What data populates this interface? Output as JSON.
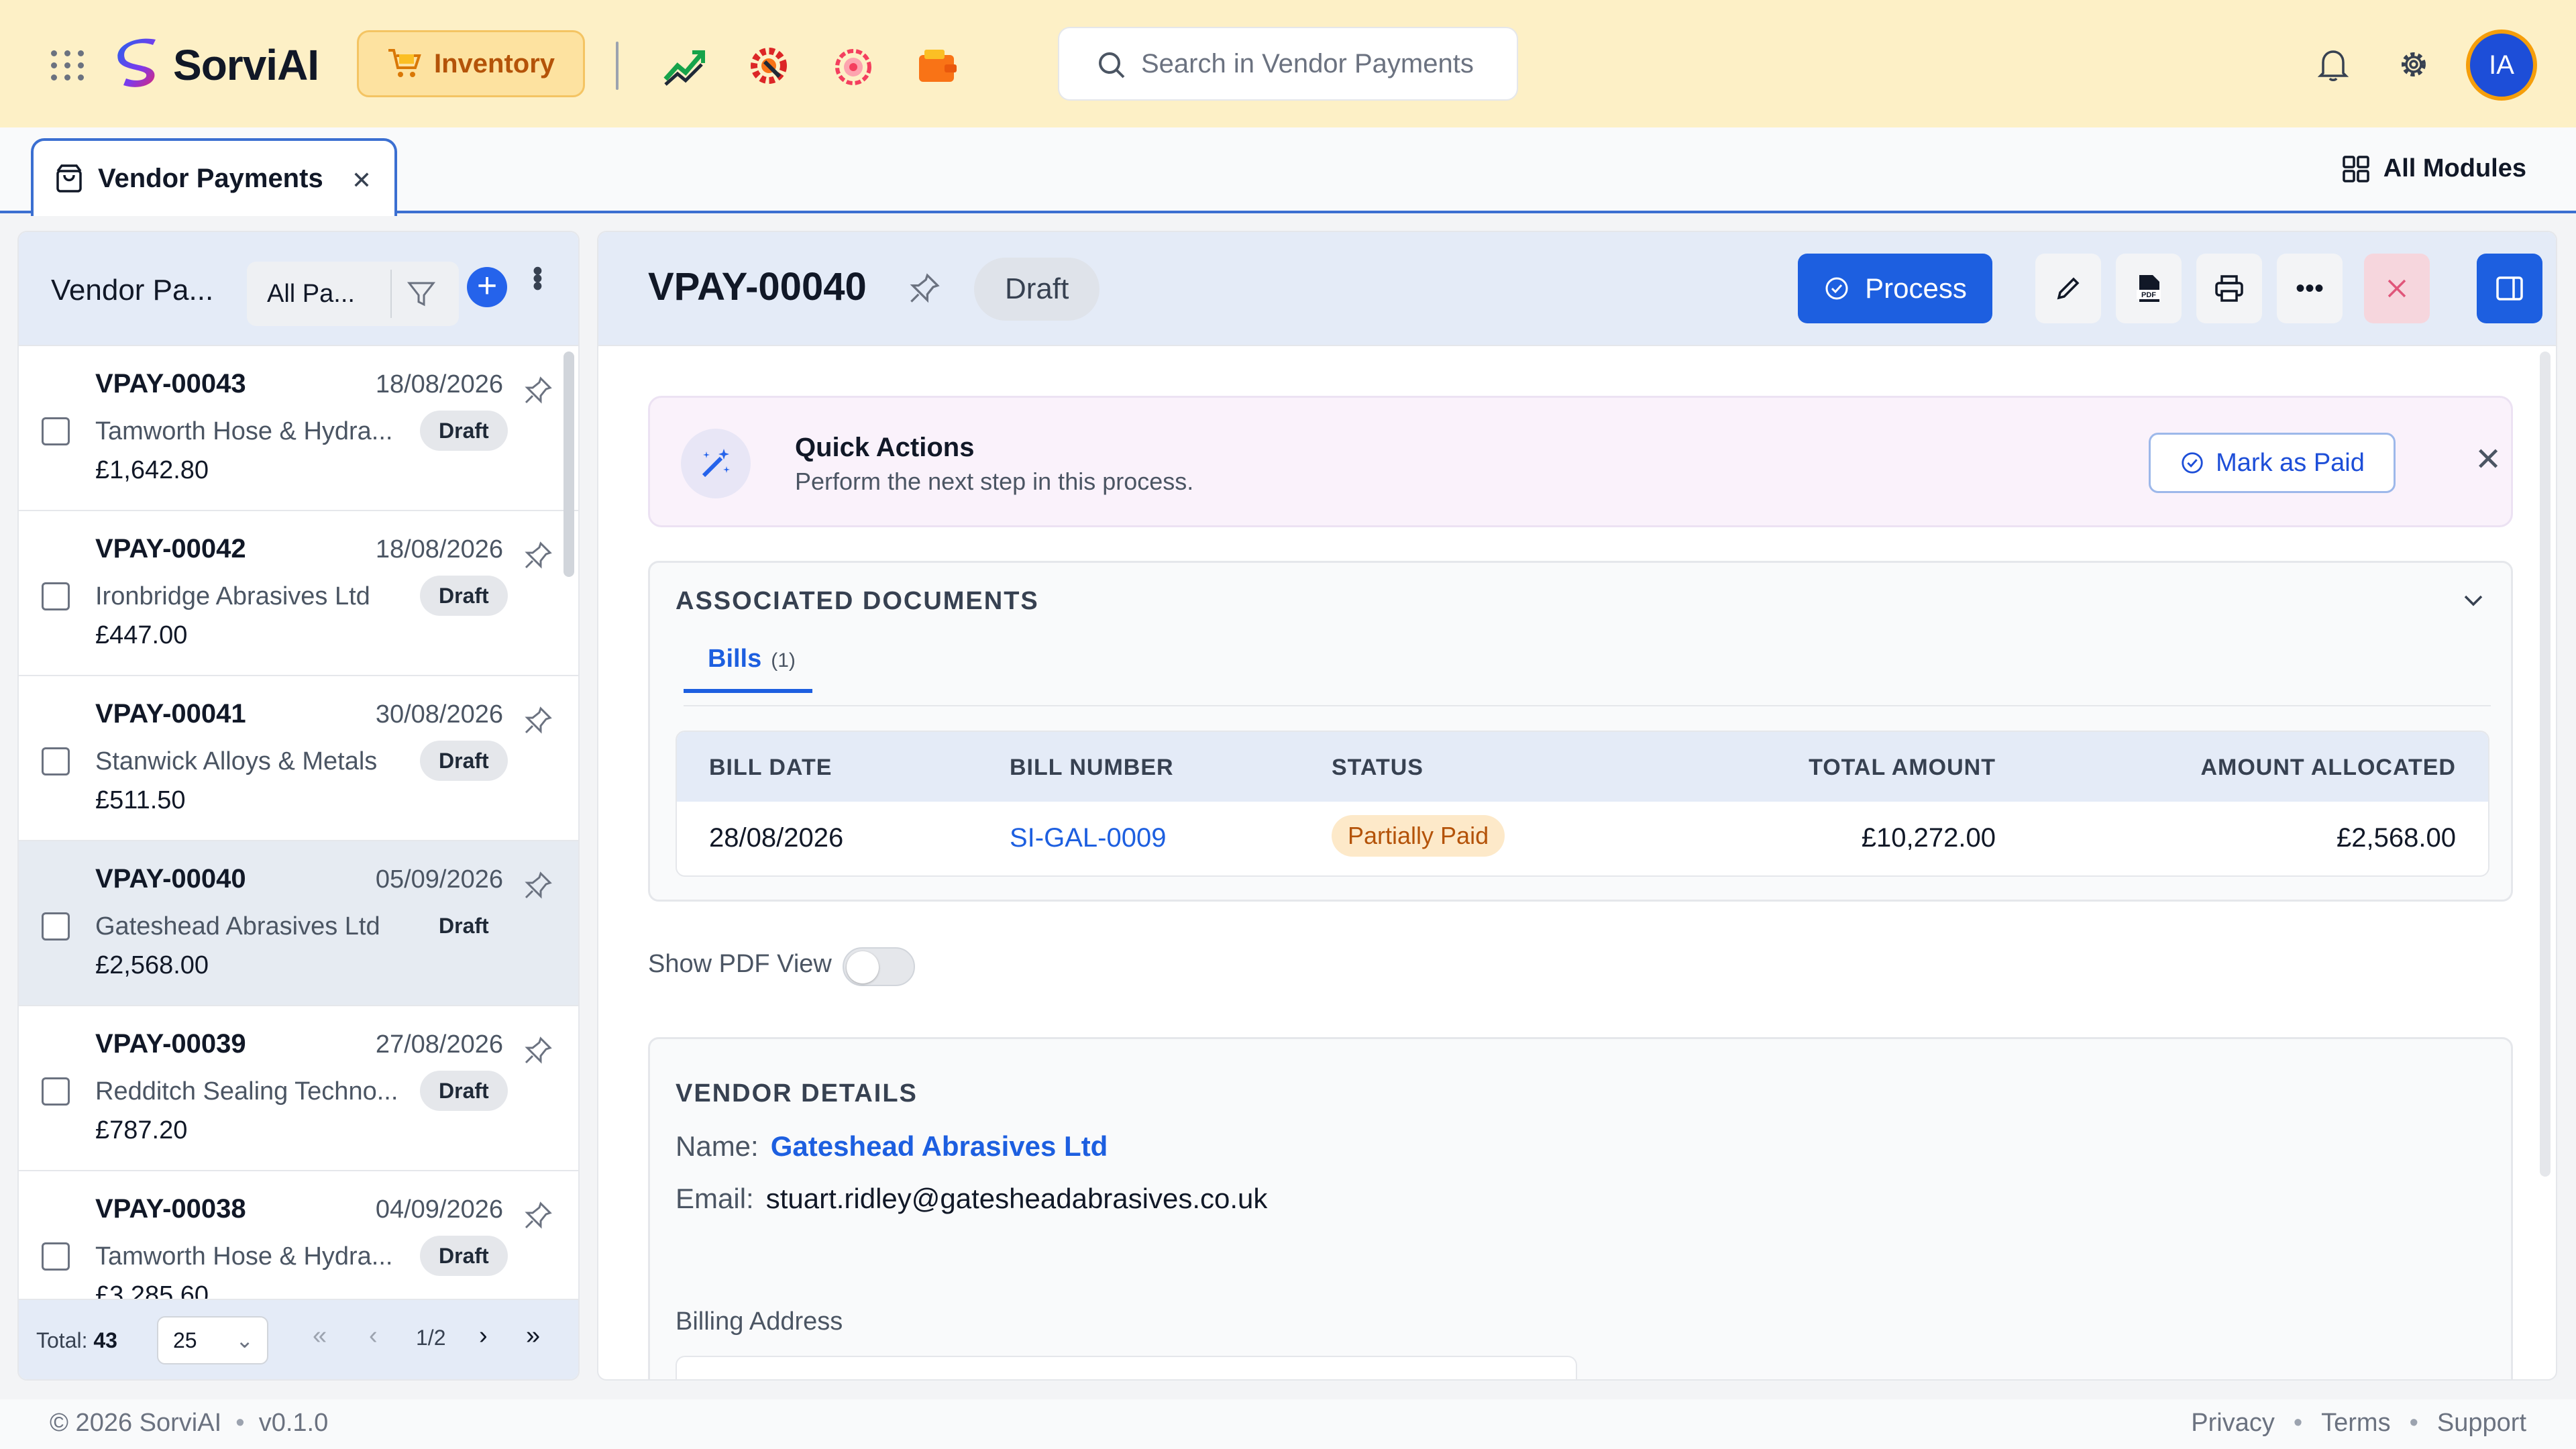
{
  "app": {
    "name": "SorviAI",
    "module_button": "Inventory",
    "search_placeholder": "Search in Vendor Payments",
    "avatar_initials": "IA",
    "brand_color": "#1d5fe0",
    "header_bg": "#fdf0c6"
  },
  "tabs": {
    "active": "Vendor Payments",
    "all_modules": "All Modules"
  },
  "list": {
    "title": "Vendor Pa...",
    "filter": "All Pa...",
    "items": [
      {
        "code": "VPAY-00043",
        "date": "18/08/2026",
        "vendor": "Tamworth Hose & Hydra...",
        "status": "Draft",
        "amount": "£1,642.80"
      },
      {
        "code": "VPAY-00042",
        "date": "18/08/2026",
        "vendor": "Ironbridge Abrasives Ltd",
        "status": "Draft",
        "amount": "£447.00"
      },
      {
        "code": "VPAY-00041",
        "date": "30/08/2026",
        "vendor": "Stanwick Alloys & Metals",
        "status": "Draft",
        "amount": "£511.50"
      },
      {
        "code": "VPAY-00040",
        "date": "05/09/2026",
        "vendor": "Gateshead Abrasives Ltd",
        "status": "Draft",
        "amount": "£2,568.00"
      },
      {
        "code": "VPAY-00039",
        "date": "27/08/2026",
        "vendor": "Redditch Sealing Techno...",
        "status": "Draft",
        "amount": "£787.20"
      },
      {
        "code": "VPAY-00038",
        "date": "04/09/2026",
        "vendor": "Tamworth Hose & Hydra...",
        "status": "Draft",
        "amount": "£3,285.60"
      }
    ],
    "footer": {
      "total_label": "Total:",
      "total_value": "43",
      "page_size": "25",
      "page_indicator": "1/2"
    }
  },
  "detail": {
    "code": "VPAY-00040",
    "status": "Draft",
    "process_button": "Process",
    "quick_actions": {
      "title": "Quick Actions",
      "subtitle": "Perform the next step in this process.",
      "button": "Mark as Paid"
    },
    "associated": {
      "title": "ASSOCIATED DOCUMENTS",
      "tab_label": "Bills",
      "tab_count": "(1)",
      "columns": [
        "BILL DATE",
        "BILL NUMBER",
        "STATUS",
        "TOTAL AMOUNT",
        "AMOUNT ALLOCATED"
      ],
      "row": {
        "bill_date": "28/08/2026",
        "bill_number": "SI-GAL-0009",
        "status": "Partially Paid",
        "total_amount": "£10,272.00",
        "amount_allocated": "£2,568.00"
      }
    },
    "pdf_toggle_label": "Show PDF View",
    "vendor": {
      "title": "VENDOR DETAILS",
      "name_label": "Name:",
      "name": "Gateshead Abrasives Ltd",
      "email_label": "Email:",
      "email": "stuart.ridley@gatesheadabrasives.co.uk",
      "billing_label": "Billing Address"
    }
  },
  "footer": {
    "copyright": "© 2026 SorviAI",
    "version": "v0.1.0",
    "links": [
      "Privacy",
      "Terms",
      "Support"
    ]
  }
}
